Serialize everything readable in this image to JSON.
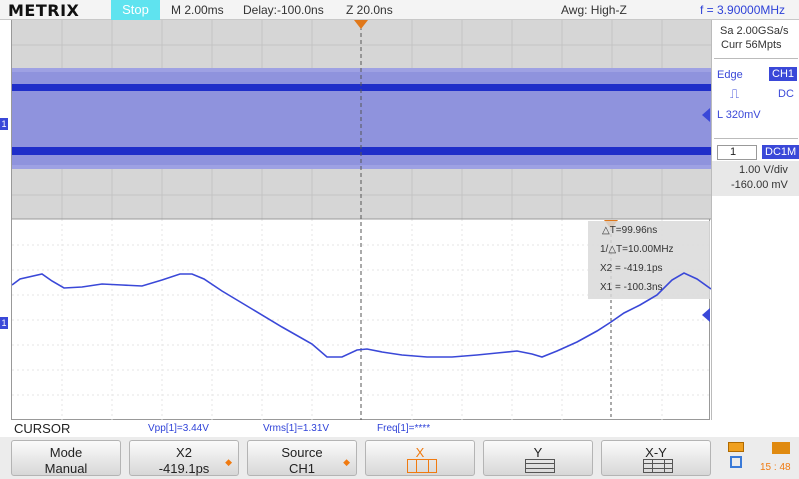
{
  "topbar": {
    "brand": "METRIX",
    "run_state": "Stop",
    "timebase": "M 2.00ms",
    "delay": "Delay:-100.0ns",
    "zoom": "Z 20.0ns",
    "acquisition": "Awg: High-Z",
    "frequency": "f = 3.90000MHz"
  },
  "right_panel": {
    "sample_rate": "Sa 2.00GSa/s",
    "memory": "Curr 56Mpts",
    "trigger_type": "Edge",
    "trigger_source": "CH1",
    "trigger_coupling": "DC",
    "trigger_level": "L  320mV",
    "channel_number": "1",
    "channel_coupling": "DC1M",
    "volts_per_div": "1.00 V/div",
    "offset": "-160.00 mV"
  },
  "cursor_readout": {
    "delta_t": "△T=99.96ns",
    "inv_delta_t": "1/△T=10.00MHz",
    "x2": "X2 = -419.1ps",
    "x1": "X1 = -100.3ns"
  },
  "status_line": {
    "mode_title": "CURSOR",
    "vpp": "Vpp[1]=3.44V",
    "vrms": "Vrms[1]=1.31V",
    "freq": "Freq[1]=****"
  },
  "softkeys": [
    {
      "line1": "Mode",
      "line2": "Manual"
    },
    {
      "line1": "X2",
      "line2": "-419.1ps"
    },
    {
      "line1": "Source",
      "line2": "CH1"
    },
    {
      "line1": "X",
      "line2": ""
    },
    {
      "line1": "Y",
      "line2": ""
    },
    {
      "line1": "X-Y",
      "line2": ""
    }
  ],
  "clock": "15 : 48",
  "colors": {
    "trace": "#3a48d8",
    "accent": "#f07a10",
    "stop_badge": "#5fe3ef"
  },
  "icons": [
    "trigger-marker-icon",
    "rising-edge-icon",
    "channel-1-marker-icon",
    "usb-icon",
    "network-icon",
    "printer-icon"
  ]
}
